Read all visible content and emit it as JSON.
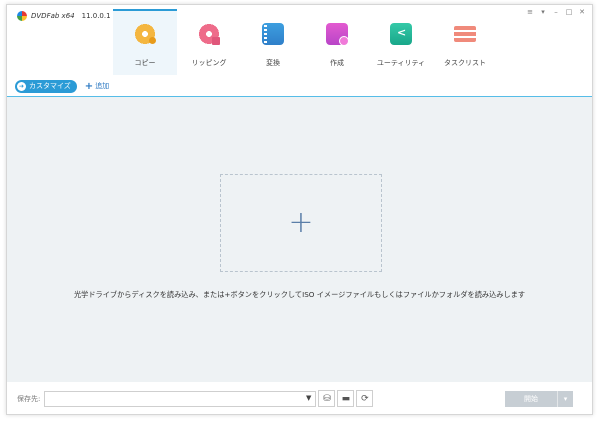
{
  "app": {
    "name": "DVDFab x64",
    "version": "11.0.0.1"
  },
  "window_controls": [
    "≡",
    "▾",
    "–",
    "□",
    "✕"
  ],
  "tabs": [
    {
      "label": "コピー",
      "icon": "copy-disc-icon",
      "active": true
    },
    {
      "label": "リッピング",
      "icon": "ripper-disc-icon",
      "active": false
    },
    {
      "label": "変換",
      "icon": "converter-film-icon",
      "active": false
    },
    {
      "label": "作成",
      "icon": "creator-icon",
      "active": false
    },
    {
      "label": "ユーティリティ",
      "icon": "utility-icon",
      "active": false
    },
    {
      "label": "タスクリスト",
      "icon": "task-list-icon",
      "active": false
    }
  ],
  "toolbar": {
    "customize_label": "カスタマイズ",
    "add_label": "追加"
  },
  "main": {
    "dropzone_symbol": "+",
    "hint": "光学ドライブからディスクを読み込み、または+ボタンをクリックしてISO イメージファイルもしくはファイルかフォルダを読み込みします"
  },
  "bottom": {
    "save_to_label": "保存先:",
    "destination_value": "",
    "start_label": "開始"
  },
  "colors": {
    "accent": "#2b9bd6",
    "main_bg": "#eef2f4",
    "start_disabled": "#c7ced4"
  }
}
